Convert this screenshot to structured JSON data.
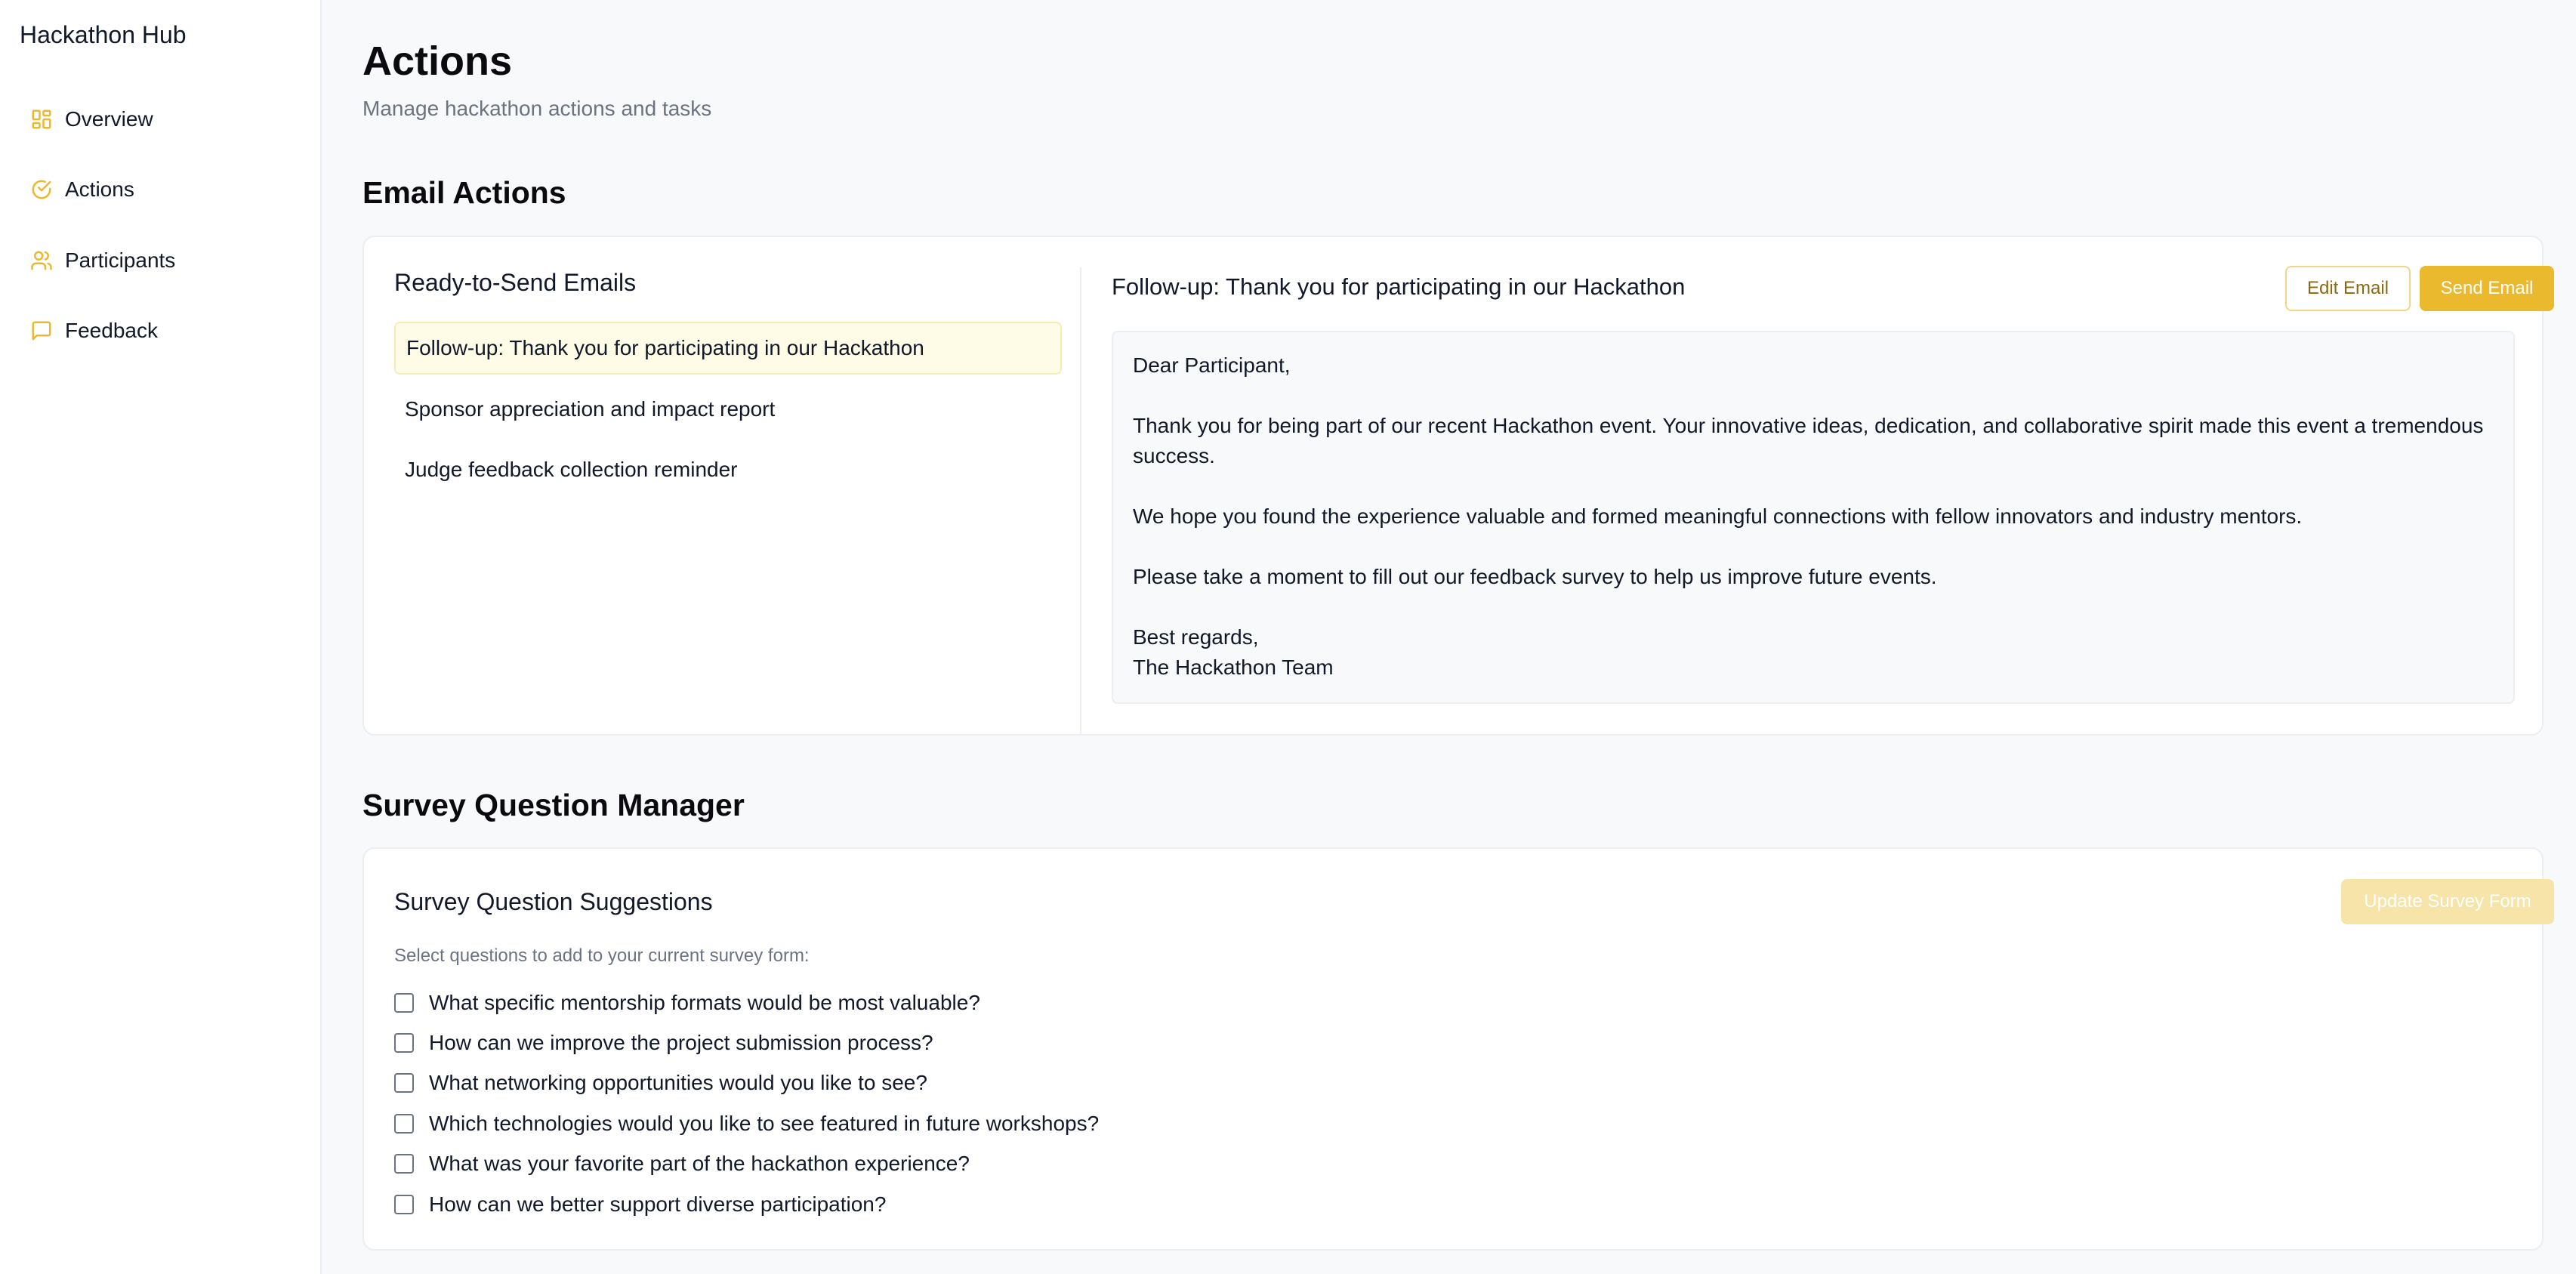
{
  "app": {
    "brand": "Hackathon Hub"
  },
  "sidebar": {
    "items": [
      {
        "label": "Overview",
        "icon": "dashboard-icon"
      },
      {
        "label": "Actions",
        "icon": "check-circle-icon"
      },
      {
        "label": "Participants",
        "icon": "users-icon"
      },
      {
        "label": "Feedback",
        "icon": "message-square-icon"
      }
    ]
  },
  "header": {
    "title": "Actions",
    "subtitle": "Manage hackathon actions and tasks"
  },
  "email_actions": {
    "section_title": "Email Actions",
    "list_title": "Ready-to-Send Emails",
    "emails": [
      "Follow-up: Thank you for participating in our Hackathon",
      "Sponsor appreciation and impact report",
      "Judge feedback collection reminder"
    ],
    "selected_subject": "Follow-up: Thank you for participating in our Hackathon",
    "edit_button": "Edit Email",
    "send_button": "Send Email",
    "body": {
      "greeting": "Dear Participant,",
      "p1": "Thank you for being part of our recent Hackathon event. Your innovative ideas, dedication, and collaborative spirit made this event a tremendous success.",
      "p2": "We hope you found the experience valuable and formed meaningful connections with fellow innovators and industry mentors.",
      "p3": "Please take a moment to fill out our feedback survey to help us improve future events.",
      "closing": "Best regards,",
      "signature": "The Hackathon Team"
    }
  },
  "survey": {
    "section_title": "Survey Question Manager",
    "card_title": "Survey Question Suggestions",
    "update_button": "Update Survey Form",
    "help_text": "Select questions to add to your current survey form:",
    "questions": [
      "What specific mentorship formats would be most valuable?",
      "How can we improve the project submission process?",
      "What networking opportunities would you like to see?",
      "Which technologies would you like to see featured in future workshops?",
      "What was your favorite part of the hackathon experience?",
      "How can we better support diverse participation?"
    ]
  },
  "colors": {
    "accent": "#eab92d",
    "selected_bg": "#fefbe6",
    "text_muted": "#6b7280"
  }
}
